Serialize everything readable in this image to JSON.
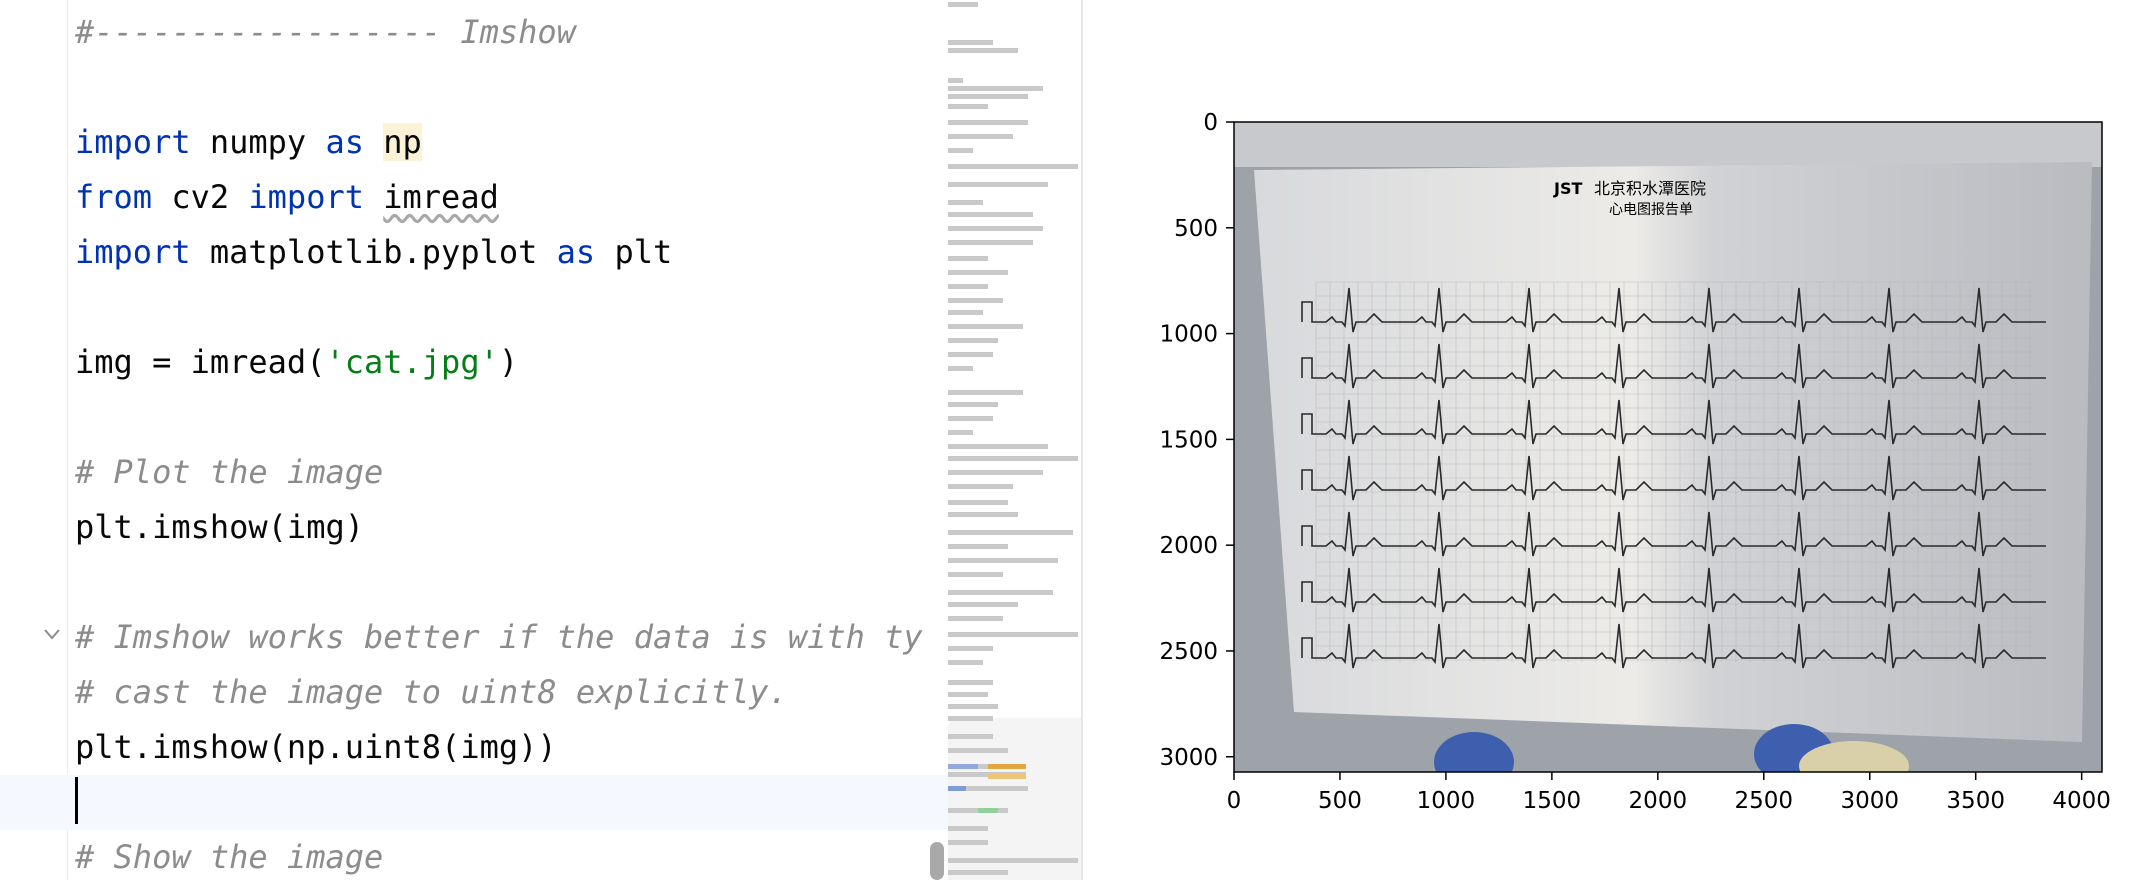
{
  "editor": {
    "lines": [
      {
        "segments": [
          {
            "text": "#------------------ Imshow",
            "cls": "cm"
          }
        ]
      },
      {
        "segments": []
      },
      {
        "segments": [
          {
            "text": "import",
            "cls": "kw"
          },
          {
            "text": " numpy "
          },
          {
            "text": "as",
            "cls": "kw"
          },
          {
            "text": " "
          },
          {
            "text": "np",
            "cls": "hl"
          }
        ]
      },
      {
        "segments": [
          {
            "text": "from",
            "cls": "kw"
          },
          {
            "text": " cv2 "
          },
          {
            "text": "import",
            "cls": "kw"
          },
          {
            "text": " "
          },
          {
            "text": "imread",
            "cls": "warn"
          }
        ]
      },
      {
        "segments": [
          {
            "text": "import",
            "cls": "kw"
          },
          {
            "text": " matplotlib.pyplot "
          },
          {
            "text": "as",
            "cls": "kw"
          },
          {
            "text": " plt"
          }
        ]
      },
      {
        "segments": []
      },
      {
        "segments": [
          {
            "text": "img = imread("
          },
          {
            "text": "'cat.jpg'",
            "cls": "str"
          },
          {
            "text": ")"
          }
        ]
      },
      {
        "segments": []
      },
      {
        "segments": [
          {
            "text": "# Plot the image",
            "cls": "cm"
          }
        ]
      },
      {
        "segments": [
          {
            "text": "plt.imshow(img)"
          }
        ]
      },
      {
        "segments": []
      },
      {
        "segments": [
          {
            "text": "# Imshow works better if the data is with ty",
            "cls": "cm"
          }
        ]
      },
      {
        "segments": [
          {
            "text": "# cast the image to uint8 explicitly.",
            "cls": "cm"
          }
        ]
      },
      {
        "segments": [
          {
            "text": "plt.imshow(np.uint8(img))"
          }
        ]
      },
      {
        "segments": [],
        "current": true
      },
      {
        "segments": [
          {
            "text": "# Show the image",
            "cls": "cm"
          }
        ]
      }
    ],
    "fold_icon": "chevron-down-icon"
  },
  "chart_data": {
    "type": "image",
    "x_ticks": [
      0,
      500,
      1000,
      1500,
      2000,
      2500,
      3000,
      3500,
      4000
    ],
    "y_ticks": [
      0,
      500,
      1000,
      1500,
      2000,
      2500,
      3000
    ],
    "xlim": [
      0,
      4096
    ],
    "ylim": [
      3072,
      0
    ],
    "image_content": {
      "header_logo": "JST",
      "header_title": "北京积水潭医院",
      "header_subtitle": "心电图报告单",
      "leads": [
        1,
        2,
        3,
        4,
        5,
        6,
        7
      ]
    }
  }
}
